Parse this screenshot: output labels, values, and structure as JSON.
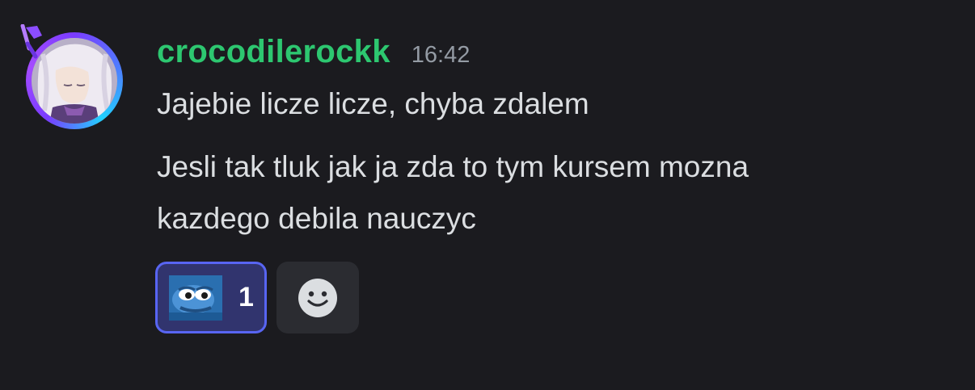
{
  "message": {
    "username": "crocodilerockk",
    "timestamp": "16:42",
    "lines": [
      "Jajebie licze licze, chyba zdalem",
      "Jesli tak tluk jak ja zda to tym kursem mozna",
      "kazdego debila nauczyc"
    ]
  },
  "reactions": [
    {
      "emoji": "pepe-frog-emoji",
      "count": "1",
      "selected": true
    }
  ],
  "add_reaction": {
    "icon": "smiley-face-icon"
  },
  "colors": {
    "background": "#1b1b1f",
    "username": "#2dc770",
    "timestamp": "#949ba4",
    "text": "#dbdee1",
    "reaction_border": "#5865f2",
    "reaction_bg": "#31346e"
  }
}
